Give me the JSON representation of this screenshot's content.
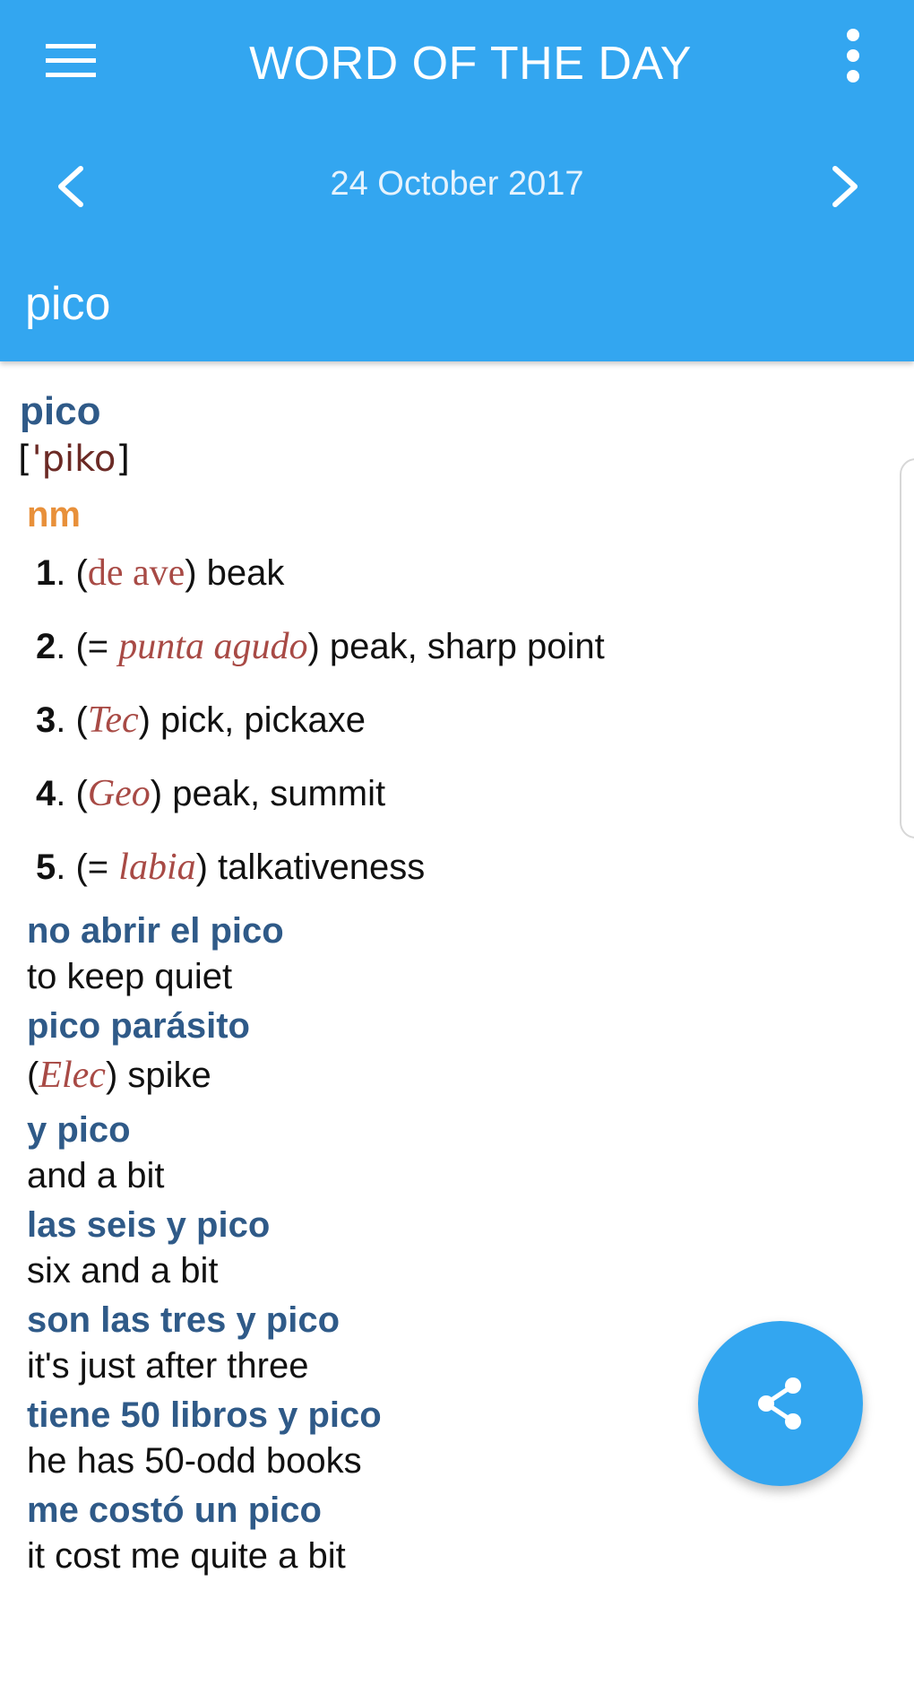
{
  "colors": {
    "accent": "#33a6f0",
    "headword": "#2f5a88",
    "part_of_speech": "#e8903a",
    "label": "#a84a45"
  },
  "header": {
    "menu_icon": "hamburger-menu-icon",
    "title": "WORD OF THE DAY",
    "overflow_icon": "more-vert-icon",
    "prev_icon": "chevron-left-icon",
    "date": "24 October 2017",
    "next_icon": "chevron-right-icon",
    "word": "pico"
  },
  "entry": {
    "headword": "pico",
    "pronunciation_open": "[",
    "pronunciation": "'piko",
    "pronunciation_close": "]",
    "part_of_speech": "nm",
    "senses": [
      {
        "num": "1",
        "pre": "(",
        "label": "de ave",
        "label_italic": false,
        "post": ") beak"
      },
      {
        "num": "2",
        "pre": "(= ",
        "label": "punta agudo",
        "label_italic": true,
        "post": ") peak, sharp point"
      },
      {
        "num": "3",
        "pre": "(",
        "label": "Tec",
        "label_italic": true,
        "post": ") pick, pickaxe"
      },
      {
        "num": "4",
        "pre": "(",
        "label": "Geo",
        "label_italic": true,
        "post": ") peak, summit"
      },
      {
        "num": "5",
        "pre": "(= ",
        "label": "labia",
        "label_italic": true,
        "post": ") talkativeness"
      }
    ],
    "phrases": [
      {
        "phrase": "no abrir el pico",
        "pre": "",
        "label": "",
        "translation": "to keep quiet"
      },
      {
        "phrase": "pico parásito",
        "pre": "(",
        "label": "Elec",
        "translation": ") spike"
      },
      {
        "phrase": "y pico",
        "pre": "",
        "label": "",
        "translation": "and a bit"
      },
      {
        "phrase": "las seis y pico",
        "pre": "",
        "label": "",
        "translation": "six and a bit"
      },
      {
        "phrase": "son las tres y pico",
        "pre": "",
        "label": "",
        "translation": "it's just after three"
      },
      {
        "phrase": "tiene 50 libros y pico",
        "pre": "",
        "label": "",
        "translation": "he has 50-odd books"
      },
      {
        "phrase": "me costó un pico",
        "pre": "",
        "label": "",
        "translation": "it cost me quite a bit"
      }
    ]
  },
  "fab": {
    "icon": "share-icon"
  }
}
